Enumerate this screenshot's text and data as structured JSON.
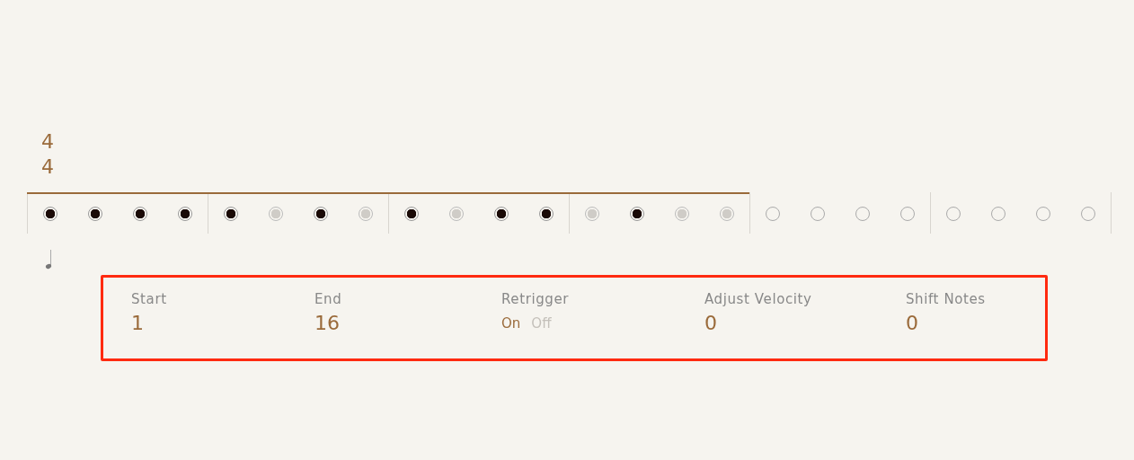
{
  "time_signature": {
    "numerator": "4",
    "denominator": "4"
  },
  "steps": [
    {
      "kind": "on"
    },
    {
      "kind": "on"
    },
    {
      "kind": "on"
    },
    {
      "kind": "on"
    },
    {
      "kind": "on"
    },
    {
      "kind": "off"
    },
    {
      "kind": "on"
    },
    {
      "kind": "off"
    },
    {
      "kind": "on"
    },
    {
      "kind": "off"
    },
    {
      "kind": "on"
    },
    {
      "kind": "on"
    },
    {
      "kind": "off"
    },
    {
      "kind": "on"
    },
    {
      "kind": "off"
    },
    {
      "kind": "off"
    },
    {
      "kind": "outside"
    },
    {
      "kind": "outside"
    },
    {
      "kind": "outside"
    },
    {
      "kind": "outside"
    },
    {
      "kind": "outside"
    },
    {
      "kind": "outside"
    },
    {
      "kind": "outside"
    },
    {
      "kind": "outside"
    }
  ],
  "settings": [
    {
      "kind": "value",
      "label": "Start",
      "value": "1"
    },
    {
      "kind": "value",
      "label": "End",
      "value": "16"
    },
    {
      "kind": "toggle",
      "label": "Retrigger",
      "options": [
        {
          "label": "On",
          "selected": true
        },
        {
          "label": "Off",
          "selected": false
        }
      ]
    },
    {
      "kind": "value",
      "label": "Adjust Velocity",
      "value": "0"
    },
    {
      "kind": "value",
      "label": "Shift Notes",
      "value": "0"
    }
  ]
}
